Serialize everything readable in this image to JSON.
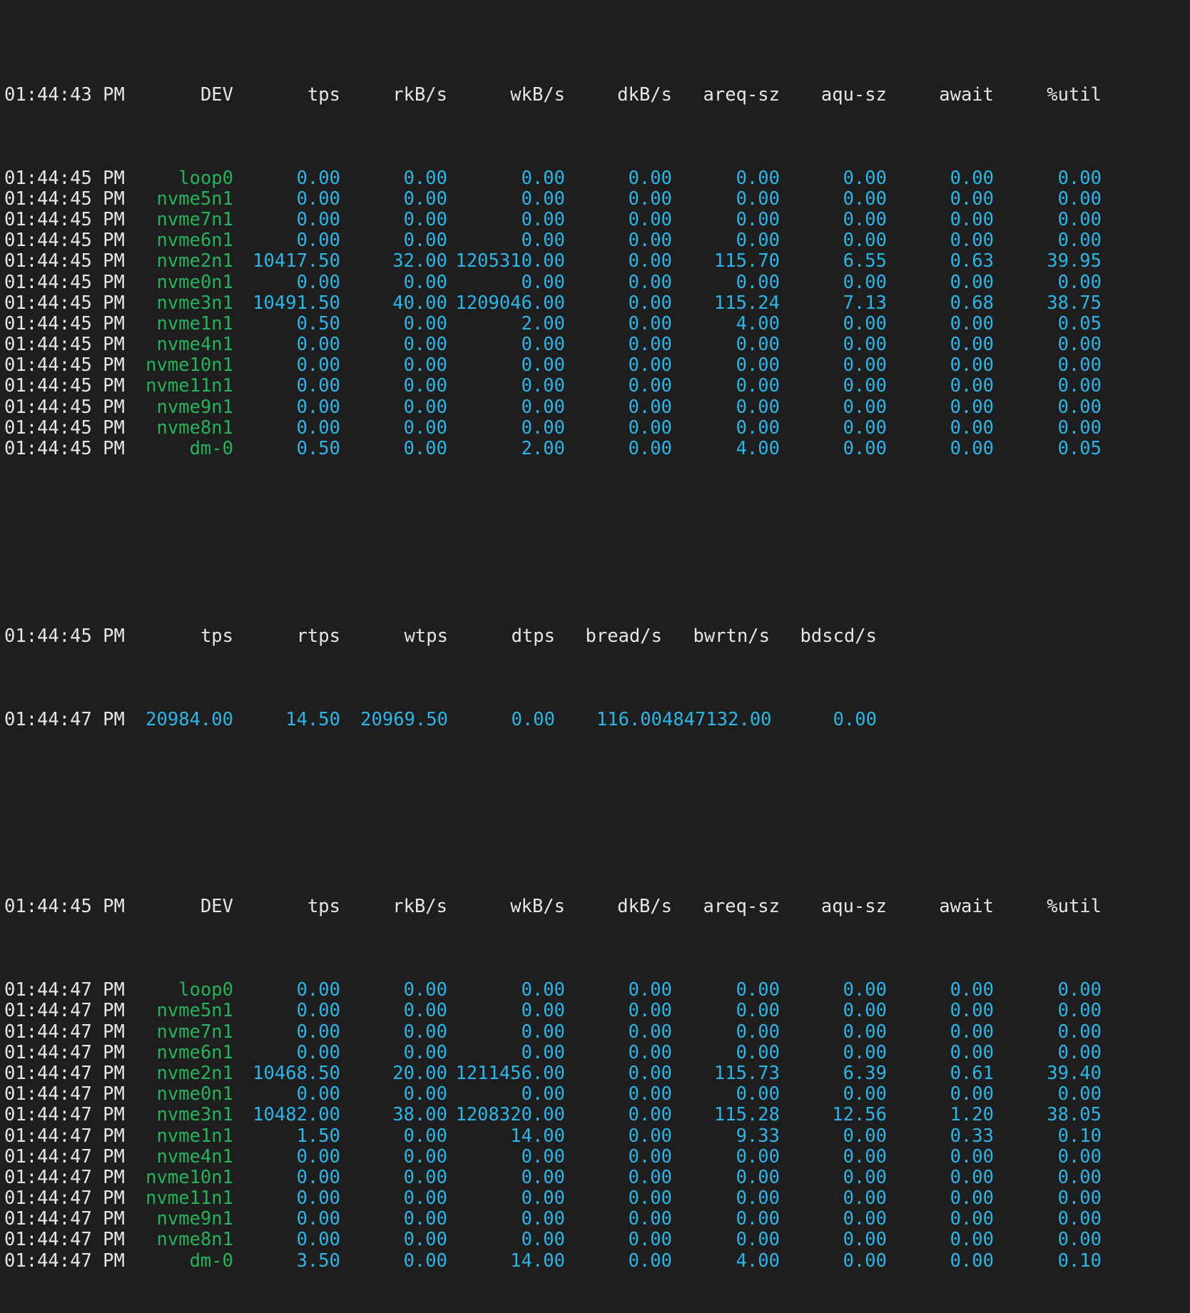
{
  "colors": {
    "background": "#1e1e1e",
    "text": "#e6e6e6",
    "device": "#23b35a",
    "number": "#29b6e8"
  },
  "block1": {
    "header": {
      "time": "01:44:43 PM",
      "cols": [
        "DEV",
        "tps",
        "rkB/s",
        "wkB/s",
        "dkB/s",
        "areq-sz",
        "aqu-sz",
        "await",
        "%util"
      ]
    },
    "rows": [
      {
        "time": "01:44:45 PM",
        "dev": "loop0",
        "tps": "0.00",
        "rkb": "0.00",
        "wkb": "0.00",
        "dkb": "0.00",
        "areq": "0.00",
        "aqu": "0.00",
        "await": "0.00",
        "util": "0.00"
      },
      {
        "time": "01:44:45 PM",
        "dev": "nvme5n1",
        "tps": "0.00",
        "rkb": "0.00",
        "wkb": "0.00",
        "dkb": "0.00",
        "areq": "0.00",
        "aqu": "0.00",
        "await": "0.00",
        "util": "0.00"
      },
      {
        "time": "01:44:45 PM",
        "dev": "nvme7n1",
        "tps": "0.00",
        "rkb": "0.00",
        "wkb": "0.00",
        "dkb": "0.00",
        "areq": "0.00",
        "aqu": "0.00",
        "await": "0.00",
        "util": "0.00"
      },
      {
        "time": "01:44:45 PM",
        "dev": "nvme6n1",
        "tps": "0.00",
        "rkb": "0.00",
        "wkb": "0.00",
        "dkb": "0.00",
        "areq": "0.00",
        "aqu": "0.00",
        "await": "0.00",
        "util": "0.00"
      },
      {
        "time": "01:44:45 PM",
        "dev": "nvme2n1",
        "tps": "10417.50",
        "rkb": "32.00",
        "wkb": "1205310.00",
        "dkb": "0.00",
        "areq": "115.70",
        "aqu": "6.55",
        "await": "0.63",
        "util": "39.95"
      },
      {
        "time": "01:44:45 PM",
        "dev": "nvme0n1",
        "tps": "0.00",
        "rkb": "0.00",
        "wkb": "0.00",
        "dkb": "0.00",
        "areq": "0.00",
        "aqu": "0.00",
        "await": "0.00",
        "util": "0.00"
      },
      {
        "time": "01:44:45 PM",
        "dev": "nvme3n1",
        "tps": "10491.50",
        "rkb": "40.00",
        "wkb": "1209046.00",
        "dkb": "0.00",
        "areq": "115.24",
        "aqu": "7.13",
        "await": "0.68",
        "util": "38.75"
      },
      {
        "time": "01:44:45 PM",
        "dev": "nvme1n1",
        "tps": "0.50",
        "rkb": "0.00",
        "wkb": "2.00",
        "dkb": "0.00",
        "areq": "4.00",
        "aqu": "0.00",
        "await": "0.00",
        "util": "0.05"
      },
      {
        "time": "01:44:45 PM",
        "dev": "nvme4n1",
        "tps": "0.00",
        "rkb": "0.00",
        "wkb": "0.00",
        "dkb": "0.00",
        "areq": "0.00",
        "aqu": "0.00",
        "await": "0.00",
        "util": "0.00"
      },
      {
        "time": "01:44:45 PM",
        "dev": "nvme10n1",
        "tps": "0.00",
        "rkb": "0.00",
        "wkb": "0.00",
        "dkb": "0.00",
        "areq": "0.00",
        "aqu": "0.00",
        "await": "0.00",
        "util": "0.00"
      },
      {
        "time": "01:44:45 PM",
        "dev": "nvme11n1",
        "tps": "0.00",
        "rkb": "0.00",
        "wkb": "0.00",
        "dkb": "0.00",
        "areq": "0.00",
        "aqu": "0.00",
        "await": "0.00",
        "util": "0.00"
      },
      {
        "time": "01:44:45 PM",
        "dev": "nvme9n1",
        "tps": "0.00",
        "rkb": "0.00",
        "wkb": "0.00",
        "dkb": "0.00",
        "areq": "0.00",
        "aqu": "0.00",
        "await": "0.00",
        "util": "0.00"
      },
      {
        "time": "01:44:45 PM",
        "dev": "nvme8n1",
        "tps": "0.00",
        "rkb": "0.00",
        "wkb": "0.00",
        "dkb": "0.00",
        "areq": "0.00",
        "aqu": "0.00",
        "await": "0.00",
        "util": "0.00"
      },
      {
        "time": "01:44:45 PM",
        "dev": "dm-0",
        "tps": "0.50",
        "rkb": "0.00",
        "wkb": "2.00",
        "dkb": "0.00",
        "areq": "4.00",
        "aqu": "0.00",
        "await": "0.00",
        "util": "0.05"
      }
    ]
  },
  "summary": {
    "header": {
      "time": "01:44:45 PM",
      "cols": [
        "tps",
        "rtps",
        "wtps",
        "dtps",
        "bread/s",
        "bwrtn/s",
        "bdscd/s"
      ]
    },
    "row": {
      "time": "01:44:47 PM",
      "tps": "20984.00",
      "rtps": "14.50",
      "wtps": "20969.50",
      "dtps": "0.00",
      "bread": "116.00",
      "bwrtn": "4847132.00",
      "bdscd": "0.00"
    }
  },
  "block2": {
    "header": {
      "time": "01:44:45 PM",
      "cols": [
        "DEV",
        "tps",
        "rkB/s",
        "wkB/s",
        "dkB/s",
        "areq-sz",
        "aqu-sz",
        "await",
        "%util"
      ]
    },
    "rows": [
      {
        "time": "01:44:47 PM",
        "dev": "loop0",
        "tps": "0.00",
        "rkb": "0.00",
        "wkb": "0.00",
        "dkb": "0.00",
        "areq": "0.00",
        "aqu": "0.00",
        "await": "0.00",
        "util": "0.00"
      },
      {
        "time": "01:44:47 PM",
        "dev": "nvme5n1",
        "tps": "0.00",
        "rkb": "0.00",
        "wkb": "0.00",
        "dkb": "0.00",
        "areq": "0.00",
        "aqu": "0.00",
        "await": "0.00",
        "util": "0.00"
      },
      {
        "time": "01:44:47 PM",
        "dev": "nvme7n1",
        "tps": "0.00",
        "rkb": "0.00",
        "wkb": "0.00",
        "dkb": "0.00",
        "areq": "0.00",
        "aqu": "0.00",
        "await": "0.00",
        "util": "0.00"
      },
      {
        "time": "01:44:47 PM",
        "dev": "nvme6n1",
        "tps": "0.00",
        "rkb": "0.00",
        "wkb": "0.00",
        "dkb": "0.00",
        "areq": "0.00",
        "aqu": "0.00",
        "await": "0.00",
        "util": "0.00"
      },
      {
        "time": "01:44:47 PM",
        "dev": "nvme2n1",
        "tps": "10468.50",
        "rkb": "20.00",
        "wkb": "1211456.00",
        "dkb": "0.00",
        "areq": "115.73",
        "aqu": "6.39",
        "await": "0.61",
        "util": "39.40"
      },
      {
        "time": "01:44:47 PM",
        "dev": "nvme0n1",
        "tps": "0.00",
        "rkb": "0.00",
        "wkb": "0.00",
        "dkb": "0.00",
        "areq": "0.00",
        "aqu": "0.00",
        "await": "0.00",
        "util": "0.00"
      },
      {
        "time": "01:44:47 PM",
        "dev": "nvme3n1",
        "tps": "10482.00",
        "rkb": "38.00",
        "wkb": "1208320.00",
        "dkb": "0.00",
        "areq": "115.28",
        "aqu": "12.56",
        "await": "1.20",
        "util": "38.05"
      },
      {
        "time": "01:44:47 PM",
        "dev": "nvme1n1",
        "tps": "1.50",
        "rkb": "0.00",
        "wkb": "14.00",
        "dkb": "0.00",
        "areq": "9.33",
        "aqu": "0.00",
        "await": "0.33",
        "util": "0.10"
      },
      {
        "time": "01:44:47 PM",
        "dev": "nvme4n1",
        "tps": "0.00",
        "rkb": "0.00",
        "wkb": "0.00",
        "dkb": "0.00",
        "areq": "0.00",
        "aqu": "0.00",
        "await": "0.00",
        "util": "0.00"
      },
      {
        "time": "01:44:47 PM",
        "dev": "nvme10n1",
        "tps": "0.00",
        "rkb": "0.00",
        "wkb": "0.00",
        "dkb": "0.00",
        "areq": "0.00",
        "aqu": "0.00",
        "await": "0.00",
        "util": "0.00"
      },
      {
        "time": "01:44:47 PM",
        "dev": "nvme11n1",
        "tps": "0.00",
        "rkb": "0.00",
        "wkb": "0.00",
        "dkb": "0.00",
        "areq": "0.00",
        "aqu": "0.00",
        "await": "0.00",
        "util": "0.00"
      },
      {
        "time": "01:44:47 PM",
        "dev": "nvme9n1",
        "tps": "0.00",
        "rkb": "0.00",
        "wkb": "0.00",
        "dkb": "0.00",
        "areq": "0.00",
        "aqu": "0.00",
        "await": "0.00",
        "util": "0.00"
      },
      {
        "time": "01:44:47 PM",
        "dev": "nvme8n1",
        "tps": "0.00",
        "rkb": "0.00",
        "wkb": "0.00",
        "dkb": "0.00",
        "areq": "0.00",
        "aqu": "0.00",
        "await": "0.00",
        "util": "0.00"
      },
      {
        "time": "01:44:47 PM",
        "dev": "dm-0",
        "tps": "3.50",
        "rkb": "0.00",
        "wkb": "14.00",
        "dkb": "0.00",
        "areq": "4.00",
        "aqu": "0.00",
        "await": "0.00",
        "util": "0.10"
      }
    ]
  }
}
